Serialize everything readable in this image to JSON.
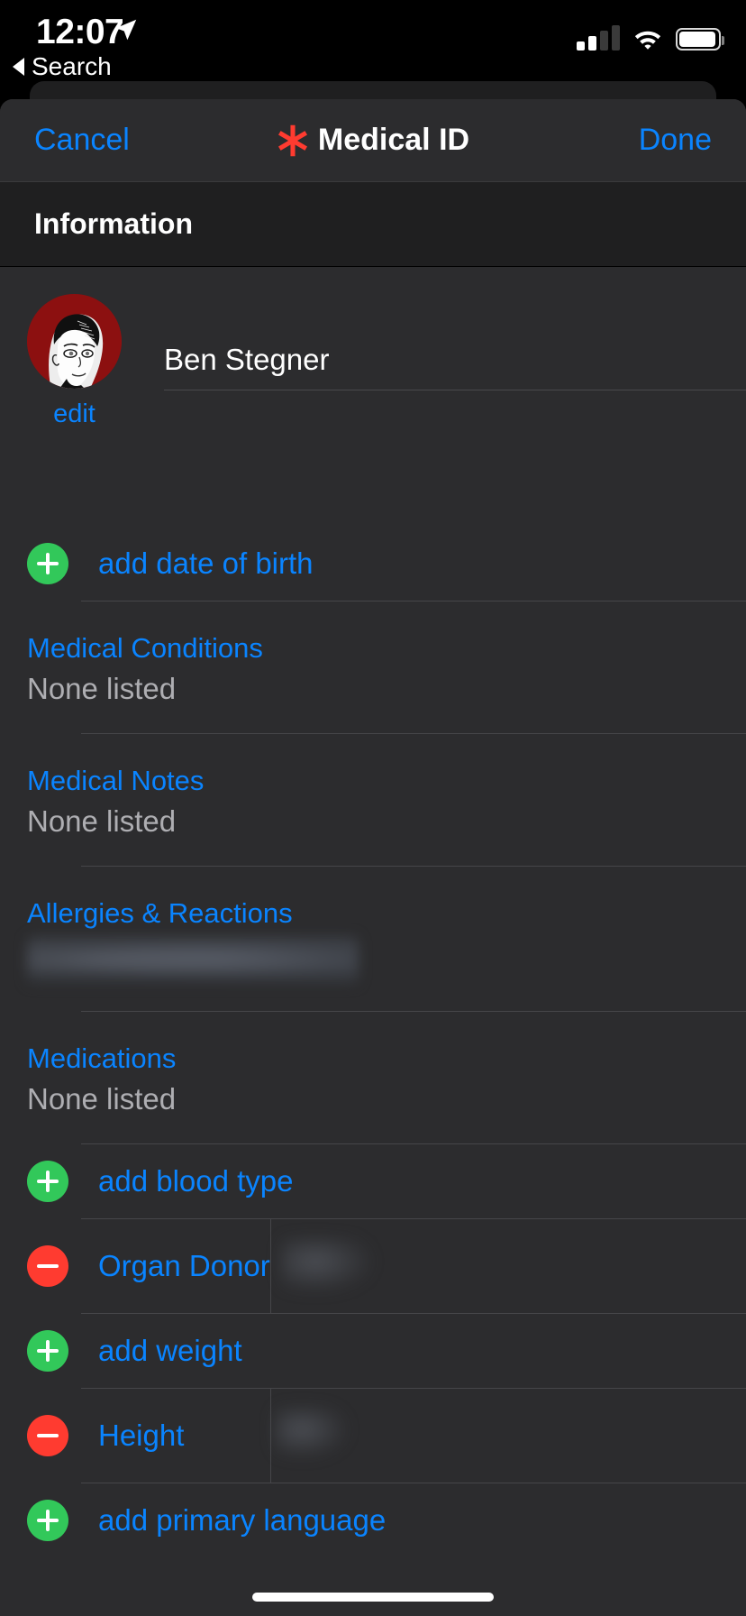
{
  "status_bar": {
    "time": "12:07",
    "location_icon": "location-arrow-icon",
    "signal_icon": "cellular-signal-icon",
    "signal_bars_filled": 2,
    "signal_bars_total": 4,
    "wifi_icon": "wifi-icon",
    "battery_icon": "battery-icon",
    "battery_level": 92
  },
  "back_link": {
    "label": "Search",
    "icon": "back-triangle-icon"
  },
  "navbar": {
    "cancel_label": "Cancel",
    "title": "Medical ID",
    "title_icon": "medical-asterisk-icon",
    "done_label": "Done"
  },
  "section_header": {
    "title": "Information"
  },
  "profile": {
    "avatar_icon": "user-avatar-photo",
    "edit_label": "edit",
    "name": "Ben Stegner"
  },
  "rows": [
    {
      "kind": "add",
      "name": "add-date-of-birth",
      "icon": "plus-circle-icon",
      "label": "add date of birth"
    },
    {
      "kind": "field",
      "name": "medical-conditions",
      "title": "Medical Conditions",
      "value": "None listed",
      "redacted": false
    },
    {
      "kind": "field",
      "name": "medical-notes",
      "title": "Medical Notes",
      "value": "None listed",
      "redacted": false
    },
    {
      "kind": "field",
      "name": "allergies-and-reactions",
      "title": "Allergies & Reactions",
      "value": "",
      "redacted": true
    },
    {
      "kind": "field",
      "name": "medications",
      "title": "Medications",
      "value": "None listed",
      "redacted": false
    },
    {
      "kind": "add",
      "name": "add-blood-type",
      "icon": "plus-circle-icon",
      "label": "add blood type"
    },
    {
      "kind": "split",
      "name": "organ-donor",
      "icon": "minus-circle-icon",
      "label": "Organ Donor",
      "value": "",
      "redacted": true
    },
    {
      "kind": "add",
      "name": "add-weight",
      "icon": "plus-circle-icon",
      "label": "add weight"
    },
    {
      "kind": "split",
      "name": "height",
      "icon": "minus-circle-icon",
      "label": "Height",
      "value": "",
      "redacted": true
    },
    {
      "kind": "add",
      "name": "add-primary-language",
      "icon": "plus-circle-icon",
      "label": "add primary language"
    }
  ],
  "colors": {
    "accent_blue": "#0a84ff",
    "add_green": "#32c85a",
    "remove_red": "#ff3b30",
    "medical_red": "#ff3b30",
    "avatar_red": "#8c1010",
    "sheet_bg": "#2c2c2e",
    "header_bg": "#1f1f20",
    "separator": "#464649",
    "value_gray": "#aeaeb2"
  },
  "home_indicator": "home-indicator-bar"
}
